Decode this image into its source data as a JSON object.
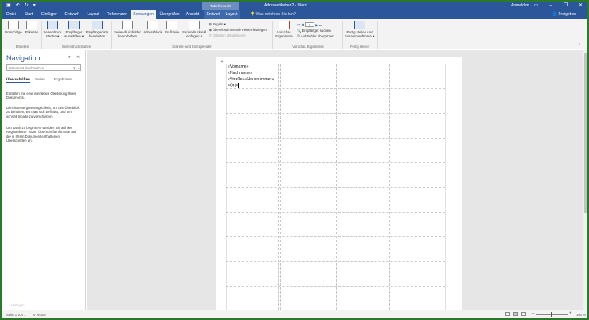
{
  "titlebar": {
    "context_tab_group": "Tabellentools",
    "document_title": "Adressetiketten2 - Word",
    "account": "Anmelden"
  },
  "tabs": [
    "Datei",
    "Start",
    "Einfügen",
    "Entwurf",
    "Layout",
    "Referenzen",
    "Sendungen",
    "Überprüfen",
    "Ansicht",
    "Entwurf",
    "Layout"
  ],
  "active_tab": "Sendungen",
  "tell_me": "Was möchten Sie tun?",
  "share": "Freigeben",
  "ribbon": {
    "groups": {
      "erstellen": "Erstellen",
      "seriendruck_starten": "Seriendruck starten",
      "schreib_felder": "Schreib- und Einfügefelder",
      "vorschau": "Vorschau Ergebnisse",
      "fertig": "Fertig stellen"
    },
    "umschlaege": "Umschläge",
    "etiketten": "Etiketten",
    "seriendruck_starten_btn": [
      "Seriendruck",
      "starten ▾"
    ],
    "empfaenger_auswaehlen": [
      "Empfänger",
      "auswählen ▾"
    ],
    "empfaengerliste_bearbeiten": [
      "Empfängerliste",
      "bearbeiten"
    ],
    "seriendruckfelder_hervorheben": [
      "Seriendruckfelder",
      "hervorheben"
    ],
    "adressblock": "Adressblock",
    "grusszeile": "Grußzeile",
    "seriendruckfeld_einfuegen": [
      "Seriendruckfeld",
      "einfügen ▾"
    ],
    "regeln": "Regeln ▾",
    "uebereinstimmende_felder": "Übereinstimmende Felder festlegen",
    "etiketten_aktualisieren": "Etiketten aktualisieren",
    "vorschau_ergebnisse": [
      "Vorschau",
      "Ergebnisse"
    ],
    "record_number": "1",
    "empfaenger_suchen": "Empfänger suchen",
    "auf_fehler": "Auf Fehler überprüfen",
    "fertig_stellen": [
      "Fertig stellen und",
      "zusammenführen ▾"
    ]
  },
  "nav": {
    "title": "Navigation",
    "search_placeholder": "Dokument durchsuchen",
    "tabs": [
      "Überschriften",
      "Seiten",
      "Ergebnisse"
    ],
    "para1": "Erstellen Sie eine interaktive Gliederung Ihres Dokuments.",
    "para2": "Dies ist eine gute Möglichkeit, um den Überblick zu behalten, wo man sich befindet, und um schnell Inhalte zu verschieben.",
    "para3": "Um damit zu beginnen, wenden Sie auf der Registerkarte \"Start\" Überschriftenformate auf die in Ihrem Dokument enthaltenen Überschriften an.",
    "footer": "Vorlagen"
  },
  "document": {
    "fields": [
      "«Vorname»",
      "«Nachname»",
      "«Straße»«Hausnummer»",
      "«Ort»"
    ]
  },
  "status": {
    "page": "Seite 1 von 1",
    "words": "0 Wörter",
    "zoom": "100 %"
  }
}
